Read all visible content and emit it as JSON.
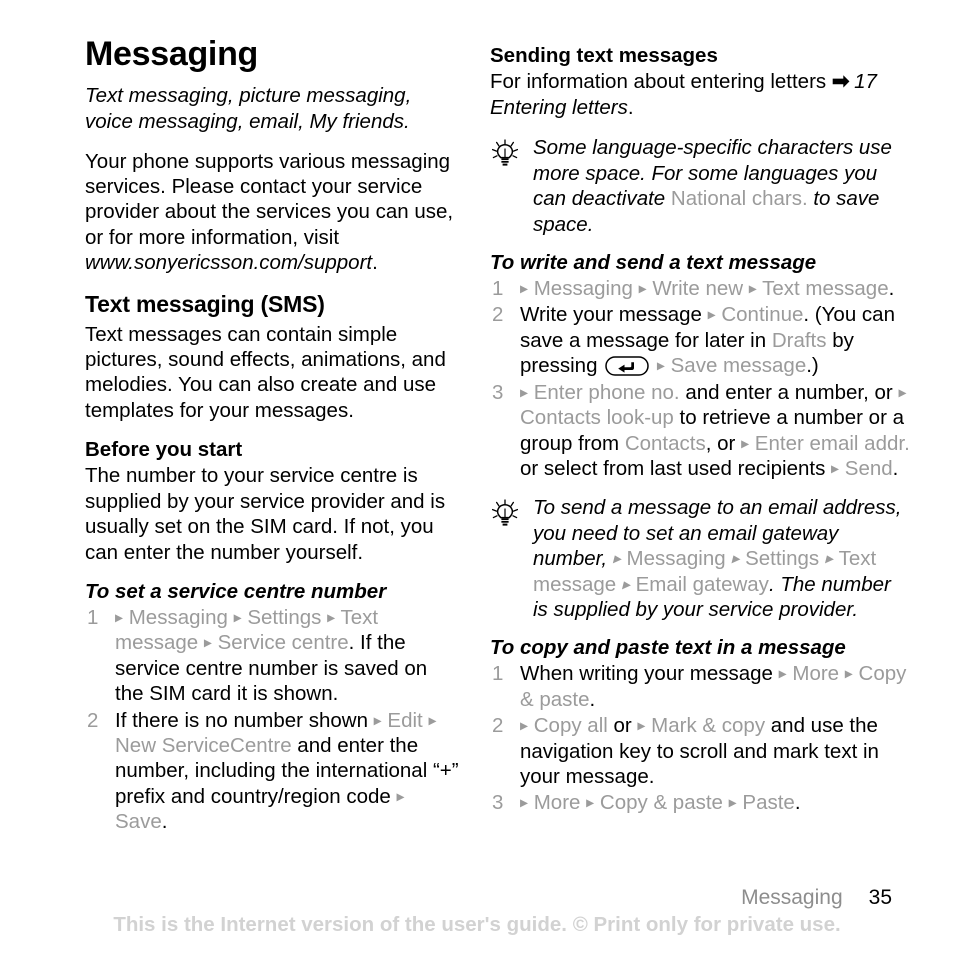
{
  "page": {
    "number": "35",
    "running_head": "Messaging",
    "footer_note": "This is the Internet version of the user's guide. © Print only for private use."
  },
  "left_column": {
    "title": "Messaging",
    "subtitle": "Text messaging, picture messaging, voice messaging, email, My friends.",
    "intro": "Your phone supports various messaging services. Please contact your service provider about the services you can use, or for more information, visit ",
    "intro_url": "www.sonyericsson.com/support",
    "section_sms": {
      "heading": "Text messaging (SMS)",
      "body": "Text messages can contain simple pictures, sound effects, animations, and melodies. You can also create and use templates for your messages."
    },
    "before_you_start": {
      "heading": "Before you start",
      "body": "The number to your service centre is supplied by your service provider and is usually set on the SIM card. If not, you can enter the number yourself."
    },
    "proc_service_centre": {
      "heading": "To set a service centre number",
      "step1": {
        "menu_messaging": "Messaging",
        "menu_settings": "Settings",
        "menu_text_message": "Text message",
        "menu_service_centre": "Service centre",
        "tail": ". If the service centre number is saved on the SIM card it is shown."
      },
      "step2": {
        "lead": "If there is no number shown ",
        "menu_edit": "Edit",
        "menu_new_service_centre": "New ServiceCentre",
        "mid": " and enter the number, including the international “+” prefix and country/region code ",
        "menu_save": "Save",
        "tail": "."
      }
    }
  },
  "right_column": {
    "sending": {
      "heading": "Sending text messages",
      "body": "For information about entering letters ",
      "xref_arrow": "➡",
      "xref": "17 Entering letters",
      "tail": "."
    },
    "tip1": {
      "icon": "lightbulb-icon",
      "part1": "Some language-specific characters use more space. For some languages you can deactivate ",
      "menu_national_chars": "National chars.",
      "part2": " to save space."
    },
    "proc_write_send": {
      "heading": "To write and send a text message",
      "step1": {
        "menu_messaging": "Messaging",
        "menu_write_new": "Write new",
        "menu_text_message": "Text message",
        "tail": "."
      },
      "step2": {
        "lead": "Write your message ",
        "menu_continue": "Continue",
        "mid1": ". (You can save a message for later in ",
        "menu_drafts": "Drafts",
        "mid2": " by pressing ",
        "key_icon": "back-key-icon",
        "menu_save_message": "Save message",
        "tail": ".)"
      },
      "step3": {
        "menu_enter_phone_no": "Enter phone no.",
        "mid1": " and enter a number, or ",
        "menu_contacts_lookup": "Contacts look-up",
        "mid2": " to retrieve a number or a group from ",
        "menu_contacts": "Contacts",
        "mid3": ", or ",
        "menu_enter_email_addr": "Enter email addr.",
        "mid4": " or select from last used recipients ",
        "menu_send": "Send",
        "tail": "."
      }
    },
    "tip2": {
      "icon": "lightbulb-icon",
      "part1": "To send a message to an email address, you need to set an email gateway number, ",
      "menu_messaging": "Messaging",
      "menu_settings": "Settings",
      "menu_text_message": "Text message",
      "menu_email_gateway": "Email gateway",
      "part2": ". The number is supplied by your service provider."
    },
    "proc_copy_paste": {
      "heading": "To copy and paste text in a message",
      "step1": {
        "lead": "When writing your message ",
        "menu_more": "More",
        "menu_copy_paste": "Copy & paste",
        "tail": "."
      },
      "step2": {
        "menu_copy_all": "Copy all",
        "mid1": " or ",
        "menu_mark_copy": "Mark & copy",
        "tail": " and use the navigation key to scroll and mark text in your message."
      },
      "step3": {
        "menu_more": "More",
        "menu_copy_paste": "Copy & paste",
        "menu_paste": "Paste",
        "tail": "."
      }
    }
  },
  "colors": {
    "menu_grey": "#9b9b9b",
    "footer_grey": "#d2d2d2",
    "running_head_grey": "#8d8d8d"
  }
}
